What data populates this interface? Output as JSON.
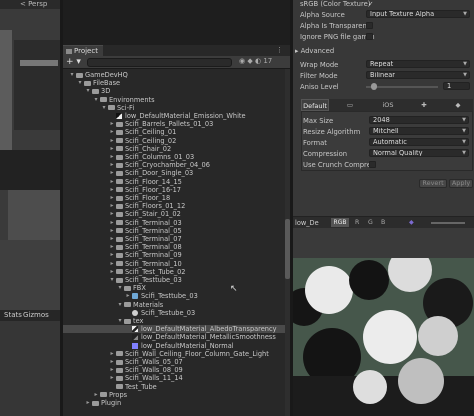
{
  "scene": {
    "persp_label": "< Persp",
    "stats_label": "Stats",
    "gizmos_label": "Gizmos"
  },
  "project": {
    "tab_label": "Project",
    "add_label": "+ ▾",
    "toolbar_badge": "17",
    "tree": [
      {
        "label": "GameDevHQ",
        "depth": 0,
        "arrow": "▾",
        "icon": "folder"
      },
      {
        "label": "FileBase",
        "depth": 1,
        "arrow": "▾",
        "icon": "folder"
      },
      {
        "label": "3D",
        "depth": 2,
        "arrow": "▾",
        "icon": "folder"
      },
      {
        "label": "Environments",
        "depth": 3,
        "arrow": "▾",
        "icon": "folder"
      },
      {
        "label": "Sci-Fi",
        "depth": 4,
        "arrow": "▾",
        "icon": "folder"
      },
      {
        "label": "low_DefaultMaterial_Emission_White",
        "depth": 5,
        "arrow": "",
        "icon": "tex-black"
      },
      {
        "label": "Scifi_Barrels_Pallets_01_03",
        "depth": 5,
        "arrow": "▸",
        "icon": "folder"
      },
      {
        "label": "Scifi_Ceiling_01",
        "depth": 5,
        "arrow": "▸",
        "icon": "folder"
      },
      {
        "label": "Scifi_Ceiling_02",
        "depth": 5,
        "arrow": "▸",
        "icon": "folder"
      },
      {
        "label": "Scifi_Chair_02",
        "depth": 5,
        "arrow": "▸",
        "icon": "folder"
      },
      {
        "label": "Scifi_Columns_01_03",
        "depth": 5,
        "arrow": "▸",
        "icon": "folder"
      },
      {
        "label": "Scifi_Cryochamber_04_06",
        "depth": 5,
        "arrow": "▸",
        "icon": "folder"
      },
      {
        "label": "Scifi_Door_Single_03",
        "depth": 5,
        "arrow": "▸",
        "icon": "folder"
      },
      {
        "label": "Scifi_Floor_14_15",
        "depth": 5,
        "arrow": "▸",
        "icon": "folder"
      },
      {
        "label": "Scifi_Floor_16-17",
        "depth": 5,
        "arrow": "▸",
        "icon": "folder"
      },
      {
        "label": "Scifi_Floor_18",
        "depth": 5,
        "arrow": "▸",
        "icon": "folder"
      },
      {
        "label": "Scifi_Floors_01_12",
        "depth": 5,
        "arrow": "▸",
        "icon": "folder"
      },
      {
        "label": "Scifi_Stair_01_02",
        "depth": 5,
        "arrow": "▸",
        "icon": "folder"
      },
      {
        "label": "Scifi_Terminal_03",
        "depth": 5,
        "arrow": "▸",
        "icon": "folder"
      },
      {
        "label": "Scifi_Terminal_05",
        "depth": 5,
        "arrow": "▸",
        "icon": "folder"
      },
      {
        "label": "Scifi_Terminal_07",
        "depth": 5,
        "arrow": "▸",
        "icon": "folder"
      },
      {
        "label": "Scifi_Terminal_08",
        "depth": 5,
        "arrow": "▸",
        "icon": "folder"
      },
      {
        "label": "Scifi_Terminal_09",
        "depth": 5,
        "arrow": "▸",
        "icon": "folder"
      },
      {
        "label": "Scifi_Terminal_10",
        "depth": 5,
        "arrow": "▸",
        "icon": "folder"
      },
      {
        "label": "Scifi_Test_Tube_02",
        "depth": 5,
        "arrow": "▸",
        "icon": "folder"
      },
      {
        "label": "Scifi_Testtube_03",
        "depth": 5,
        "arrow": "▾",
        "icon": "folder"
      },
      {
        "label": "FBX",
        "depth": 6,
        "arrow": "▾",
        "icon": "folder"
      },
      {
        "label": "Scifi_Testtube_03",
        "depth": 7,
        "arrow": "▸",
        "icon": "mesh"
      },
      {
        "label": "Materials",
        "depth": 6,
        "arrow": "▾",
        "icon": "folder"
      },
      {
        "label": "Scifi_Testube_03",
        "depth": 7,
        "arrow": "",
        "icon": "material"
      },
      {
        "label": "tex",
        "depth": 6,
        "arrow": "▾",
        "icon": "folder"
      },
      {
        "label": "low_DefaultMaterial_AlbedoTransparency",
        "depth": 7,
        "arrow": "",
        "icon": "tex-mix",
        "selected": true
      },
      {
        "label": "low_DefaultMaterial_MetallicSmoothness",
        "depth": 7,
        "arrow": "",
        "icon": "tex-dark"
      },
      {
        "label": "low_DefaultMaterial_Normal",
        "depth": 7,
        "arrow": "",
        "icon": "tex-normal"
      },
      {
        "label": "Scifi_Wall_Ceiling_Floor_Column_Gate_Light",
        "depth": 5,
        "arrow": "▸",
        "icon": "folder"
      },
      {
        "label": "Scifi_Walls_05_07",
        "depth": 5,
        "arrow": "▸",
        "icon": "folder"
      },
      {
        "label": "Scifi_Walls_08_09",
        "depth": 5,
        "arrow": "▸",
        "icon": "folder"
      },
      {
        "label": "Scifi_Walls_11_14",
        "depth": 5,
        "arrow": "▸",
        "icon": "folder"
      },
      {
        "label": "Test_Tube",
        "depth": 5,
        "arrow": "",
        "icon": "folder"
      },
      {
        "label": "Props",
        "depth": 3,
        "arrow": "▸",
        "icon": "folder"
      },
      {
        "label": "Plugin",
        "depth": 2,
        "arrow": "▸",
        "icon": "folder"
      }
    ]
  },
  "inspector": {
    "srgb_label": "sRGB (Color Texture)",
    "srgb_checked": "✓",
    "alpha_source_label": "Alpha Source",
    "alpha_source_value": "Input Texture Alpha",
    "alpha_transparency_label": "Alpha Is Transparenc",
    "ignore_png_label": "Ignore PNG file gamm",
    "advanced_label": "Advanced",
    "wrap_mode_label": "Wrap Mode",
    "wrap_mode_value": "Repeat",
    "filter_mode_label": "Filter Mode",
    "filter_mode_value": "Bilinear",
    "aniso_label": "Aniso Level",
    "aniso_value": "1",
    "platform_tab_default": "Default",
    "platform_tab_ios": "iOS",
    "max_size_label": "Max Size",
    "max_size_value": "2048",
    "resize_label": "Resize Algorithm",
    "resize_value": "Mitchell",
    "format_label": "Format",
    "format_value": "Automatic",
    "compression_label": "Compression",
    "compression_value": "Normal Quality",
    "crunch_label": "Use Crunch Compres",
    "revert_label": "Revert",
    "apply_label": "Apply",
    "preview_name": "low_De",
    "preview_rgb": "RGB",
    "preview_channels": [
      "R",
      "G",
      "B"
    ]
  },
  "colors": {
    "selection": "#4a4a4a",
    "preview_bg": "#46574b",
    "normal_map": "#8080ff"
  }
}
